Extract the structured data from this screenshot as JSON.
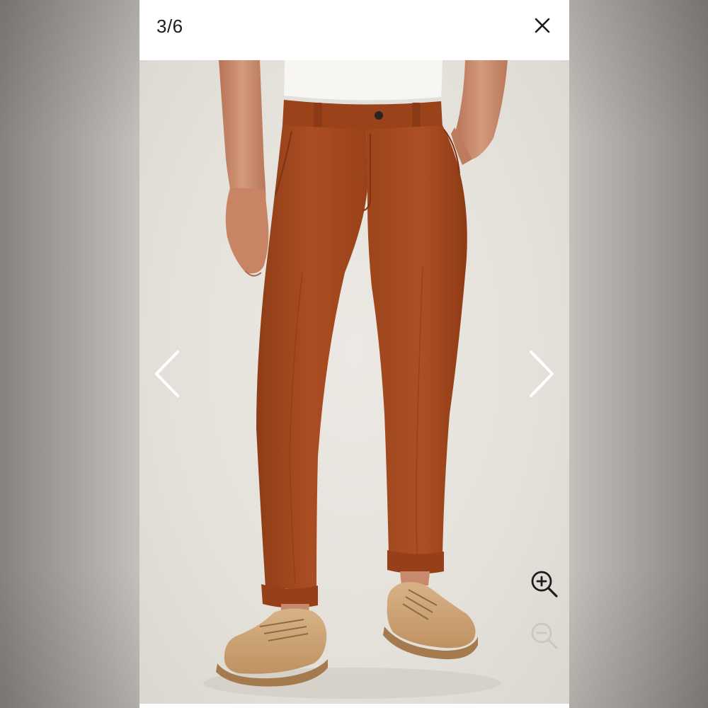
{
  "viewer": {
    "counter": "3/6",
    "current_index": 3,
    "total_images": 6
  },
  "icons": {
    "close": "close-icon",
    "previous": "chevron-left-icon",
    "next": "chevron-right-icon",
    "zoom_in": "zoom-in-icon",
    "zoom_out": "zoom-out-icon"
  },
  "colors": {
    "header_bg": "#ffffff",
    "photo_bg": "#e9e6e1",
    "pants": "#a5491f",
    "shoes": "#cfa577",
    "shirt": "#f7f6f3",
    "skin": "#c98a6a",
    "arrow": "#ffffff",
    "icon_dark": "#1c1c1c"
  }
}
